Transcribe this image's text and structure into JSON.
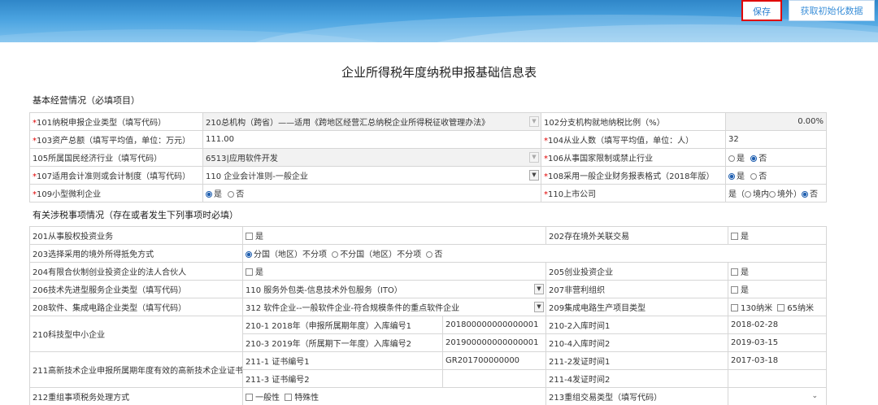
{
  "header": {
    "save_label": "保存",
    "init_label": "获取初始化数据"
  },
  "page_title": "企业所得税年度纳税申报基础信息表",
  "section1": {
    "title": "基本经营情况（必填项目）",
    "r101_label": "101纳税申报企业类型（填写代码）",
    "r101_value": "210总机构（跨省）——适用《跨地区经营汇总纳税企业所得税征收管理办法》",
    "r102_label": "102分支机构就地纳税比例（%）",
    "r102_value": "0.00%",
    "r103_label": "103资产总额（填写平均值，单位：万元）",
    "r103_value": "111.00",
    "r104_label": "104从业人数（填写平均值，单位：人）",
    "r104_value": "32",
    "r105_label": "105所属国民经济行业（填写代码）",
    "r105_value": "6513|应用软件开发",
    "r106_label": "106从事国家限制或禁止行业",
    "r107_label": "107适用会计准则或会计制度（填写代码）",
    "r107_value": "110 企业会计准则-一般企业",
    "r108_label": "108采用一般企业财务报表格式（2018年版）",
    "r109_label": "109小型微利企业",
    "r110_label": "110上市公司",
    "yes": "是",
    "no": "否",
    "r110_prefix": "是（",
    "r110_in": "境内",
    "r110_out": "境外）",
    "r110_no": "否"
  },
  "section2": {
    "title": "有关涉税事项情况（存在或者发生下列事项时必填）",
    "r201_label": "201从事股权投资业务",
    "r202_label": "202存在境外关联交易",
    "r203_label": "203选择采用的境外所得抵免方式",
    "r203_opt1": "分国（地区）不分项",
    "r203_opt2": "不分国（地区）不分项",
    "r203_opt3": "否",
    "r204_label": "204有限合伙制创业投资企业的法人合伙人",
    "r205_label": "205创业投资企业",
    "r206_label": "206技术先进型服务企业类型（填写代码）",
    "r206_value": "110 服务外包类-信息技术外包服务（ITO）",
    "r207_label": "207非营利组织",
    "r208_label": "208软件、集成电路企业类型（填写代码）",
    "r208_value": "312 软件企业--一般软件企业-符合规模条件的重点软件企业",
    "r209_label": "209集成电路生产项目类型",
    "r209_opt1": "130纳米",
    "r209_opt2": "65纳米",
    "r210_label": "210科技型中小企业",
    "r210_1_label": "210-1 2018年（申报所属期年度）入库编号1",
    "r210_1_value": "201800000000000001",
    "r210_2_label": "210-2入库时间1",
    "r210_2_value": "2018-02-28",
    "r210_3_label": "210-3 2019年（所属期下一年度）入库编号2",
    "r210_3_value": "201900000000000001",
    "r210_4_label": "210-4入库时间2",
    "r210_4_value": "2019-03-15",
    "r211_label": "211高新技术企业申报所属期年度有效的高新技术企业证书",
    "r211_1_label": "211-1 证书编号1",
    "r211_1_value": "GR201700000000",
    "r211_2_label": "211-2发证时间1",
    "r211_2_value": "2017-03-18",
    "r211_3_label": "211-3 证书编号2",
    "r211_4_label": "211-4发证时间2",
    "r212_label": "212重组事项税务处理方式",
    "r212_opt1": "一般性",
    "r212_opt2": "特殊性",
    "r213_label": "213重组交易类型（填写代码）"
  }
}
